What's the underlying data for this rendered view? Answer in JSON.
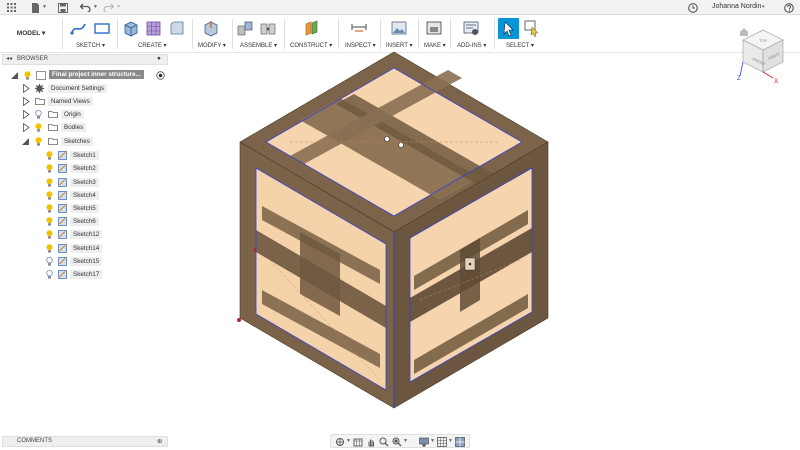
{
  "appbar": {
    "user_name": "Johanna Nordin",
    "user_caret": "▾"
  },
  "ribbon": {
    "workspace": "MODEL ▾",
    "groups": {
      "sketch": "SKETCH ▾",
      "create": "CREATE ▾",
      "modify": "MODIFY ▾",
      "assemble": "ASSEMBLE ▾",
      "construct": "CONSTRUCT ▾",
      "inspect": "INSPECT ▾",
      "insert": "INSERT ▾",
      "make": "MAKE ▾",
      "addins": "ADD-INS ▾",
      "select": "SELECT ▾"
    }
  },
  "browser": {
    "title": "BROWSER",
    "root": "Final project inner structure...",
    "items": {
      "document_settings": "Document Settings",
      "named_views": "Named Views",
      "origin": "Origin",
      "bodies": "Bodies",
      "sketches": "Sketches"
    },
    "sketches": [
      "Sketch1",
      "Sketch2",
      "Sketch3",
      "Sketch4",
      "Sketch5",
      "Sketch6",
      "Sketch12",
      "Sketch14",
      "Sketch15",
      "Sketch17"
    ]
  },
  "comments": {
    "title": "COMMENTS"
  },
  "viewcube": {
    "face_labels": [
      "FRONT",
      "RIGHT",
      "TOP"
    ],
    "axes": {
      "x": "X",
      "z": "Z"
    }
  },
  "colors": {
    "accent": "#0696d7",
    "wood": "#7b644a",
    "interior": "#f7d9b4",
    "bulb": "#f2c200",
    "edge_blue": "#3344cc"
  }
}
